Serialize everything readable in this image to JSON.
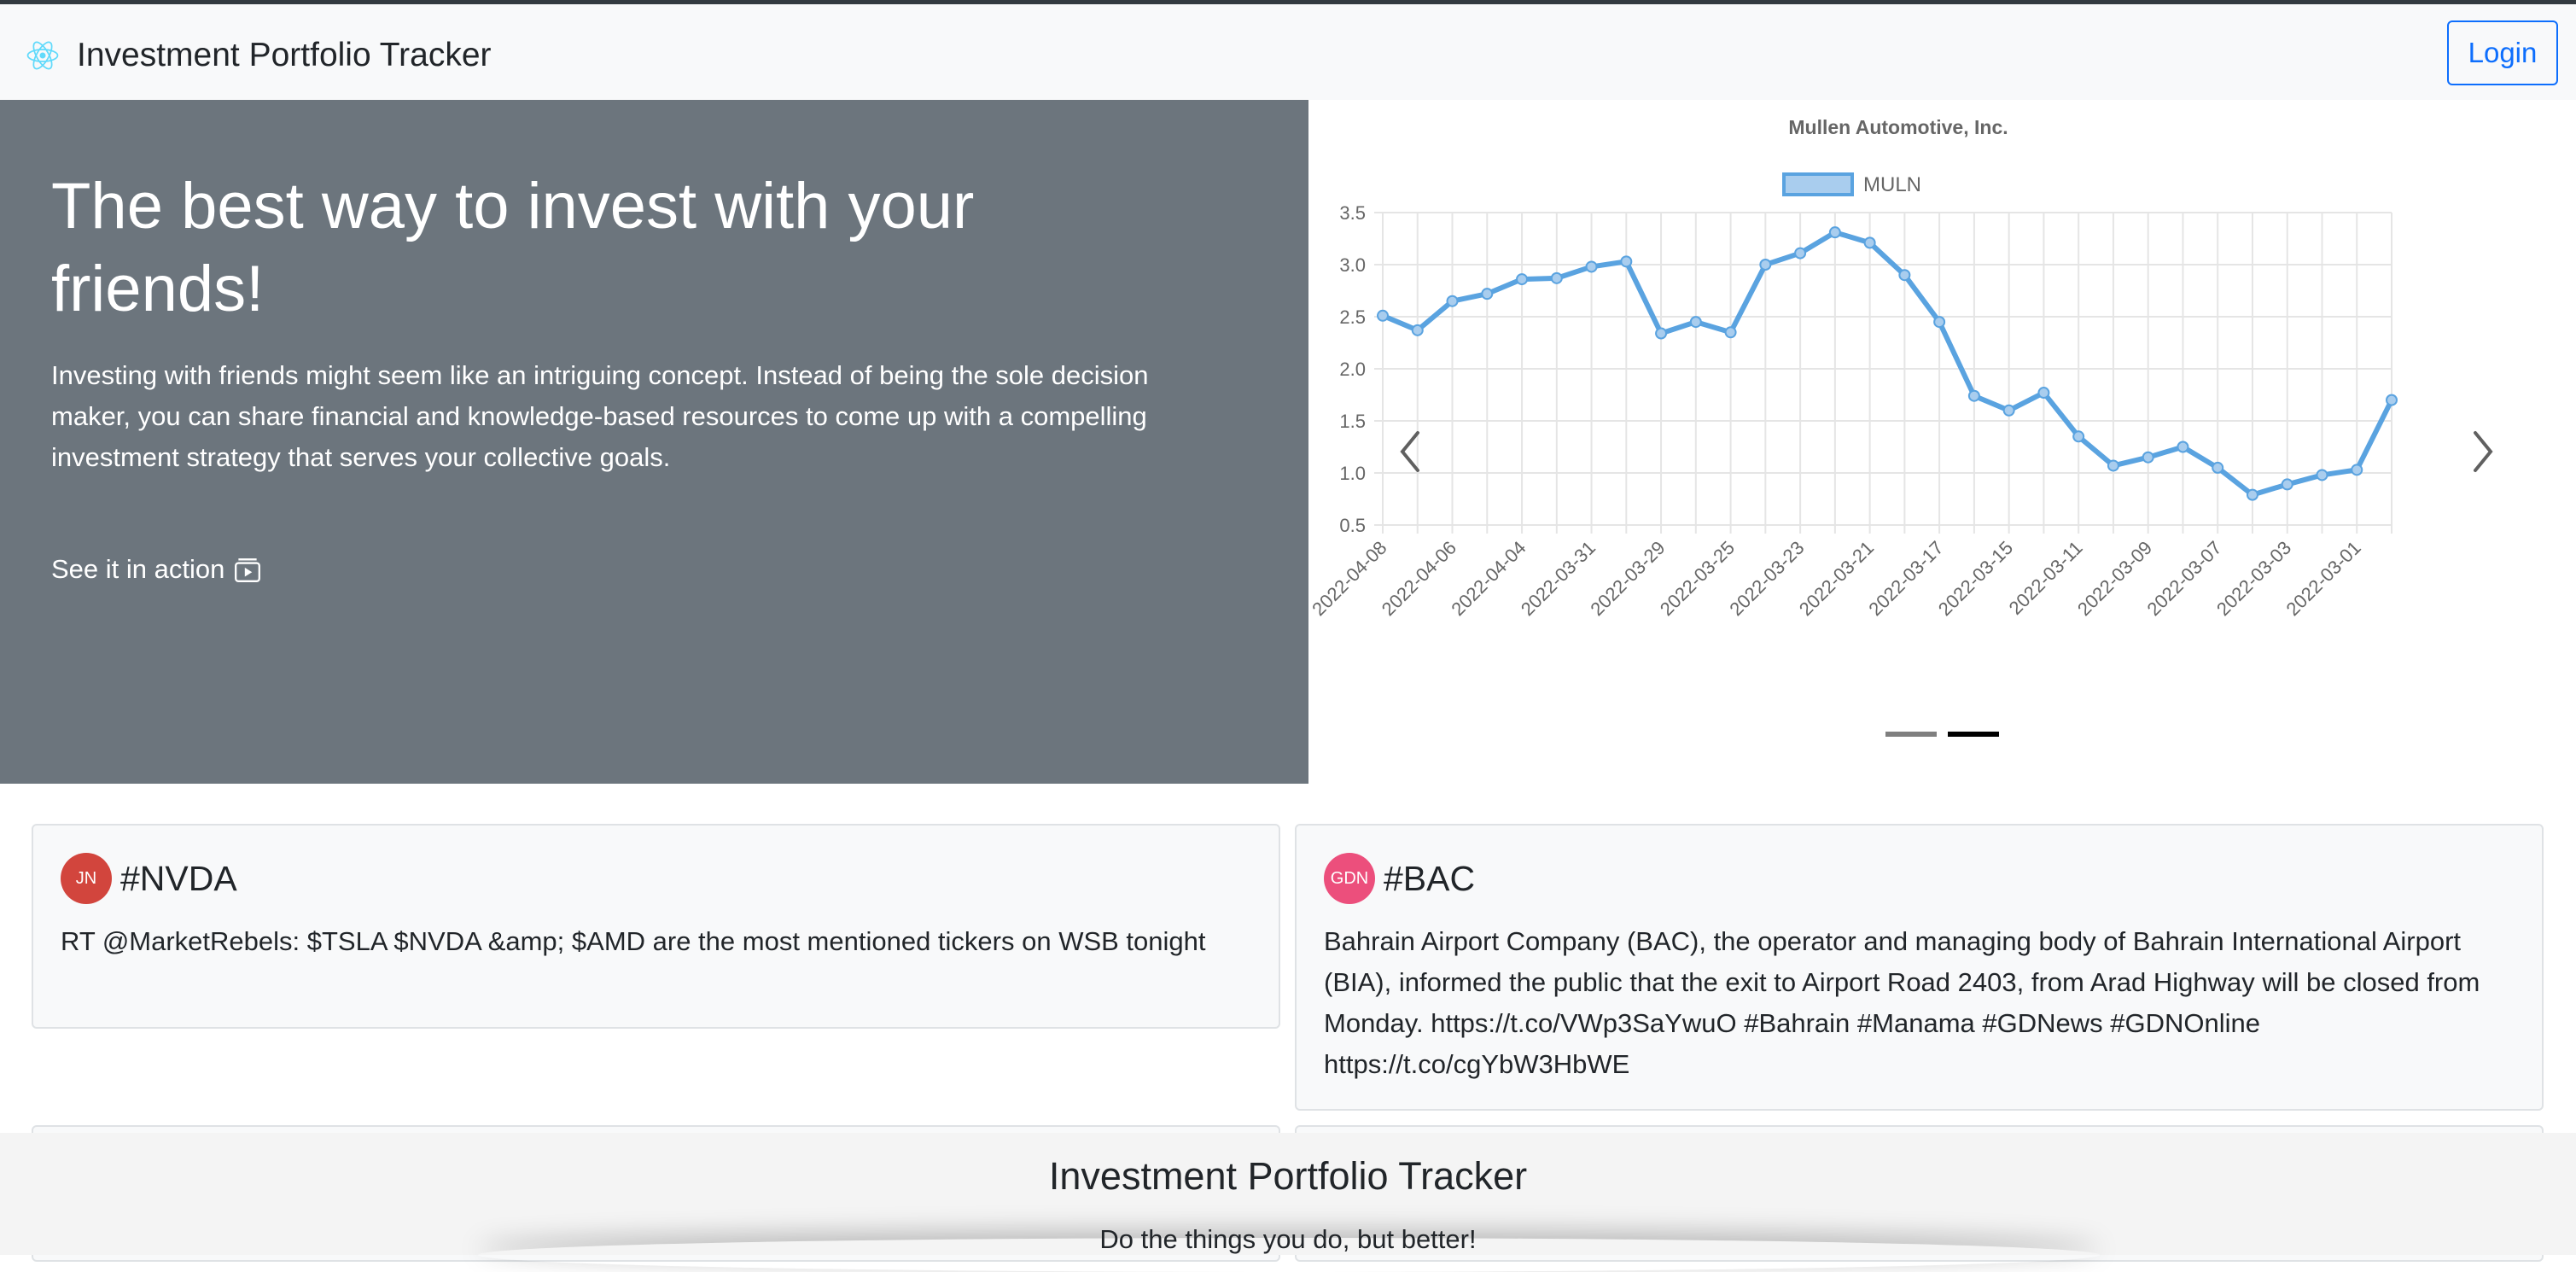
{
  "navbar": {
    "brand": "Investment Portfolio Tracker",
    "brand_icon": "react-atom-icon",
    "login_label": "Login"
  },
  "hero": {
    "title": "The best way to invest with your friends!",
    "description": "Investing with friends might seem like an intriguing concept. Instead of being the sole decision maker, you can share financial and knowledge-based resources to come up with a compelling investment strategy that serves your collective goals.",
    "cta_label": "See it in action",
    "cta_icon": "play-video-icon"
  },
  "carousel": {
    "active_slide": 2,
    "slide_count": 2
  },
  "chart_data": {
    "type": "line",
    "title": "Mullen Automotive, Inc.",
    "series": [
      {
        "name": "MULN",
        "color": "#5aa3e0",
        "values": [
          2.51,
          2.37,
          2.65,
          2.72,
          2.86,
          2.87,
          2.98,
          3.03,
          2.34,
          2.45,
          2.35,
          3.0,
          3.11,
          3.31,
          3.21,
          2.9,
          2.45,
          1.74,
          1.6,
          1.77,
          1.35,
          1.07,
          1.15,
          1.25,
          1.05,
          0.79,
          0.89,
          0.98,
          1.03,
          1.7
        ]
      }
    ],
    "x_tick_labels": [
      "2022-04-08",
      "2022-04-06",
      "2022-04-04",
      "2022-03-31",
      "2022-03-29",
      "2022-03-25",
      "2022-03-23",
      "2022-03-21",
      "2022-03-17",
      "2022-03-15",
      "2022-03-11",
      "2022-03-09",
      "2022-03-07",
      "2022-03-03",
      "2022-03-01"
    ],
    "y_ticks": [
      "0.5",
      "1.0",
      "1.5",
      "2.0",
      "2.5",
      "3.0",
      "3.5"
    ],
    "ylim": [
      0.5,
      3.5
    ],
    "grid": true,
    "legend": "top-center"
  },
  "cards": [
    {
      "avatar": "JN",
      "avatar_color": "#d2453d",
      "title": "#NVDA",
      "text": "RT @MarketRebels: $TSLA $NVDA &amp; $AMD are the most mentioned tickers on WSB tonight"
    },
    {
      "avatar": "GDN",
      "avatar_color": "#ec4f7c",
      "title": "#BAC",
      "text": "Bahrain Airport Company (BAC), the operator and managing body of Bahrain International Airport (BIA), informed the public that the exit to Airport Road 2403, from Arad Highway will be closed from Monday. https://t.co/VWp3SaYwuO #Bahrain #Manama #GDNews #GDNOnline https://t.co/cgYbW3HbWE"
    }
  ],
  "footer": {
    "title": "Investment Portfolio Tracker",
    "subtitle": "Do the things you do, but better!"
  }
}
